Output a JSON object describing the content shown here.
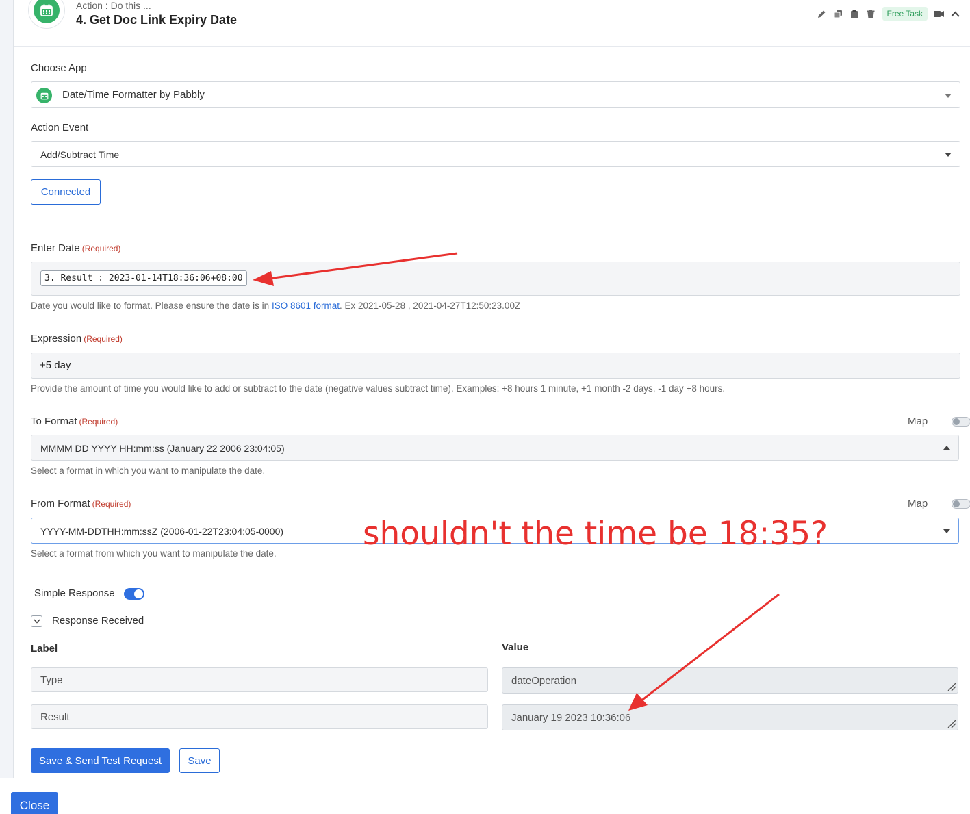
{
  "header": {
    "subtitle": "Action : Do this ...",
    "title": "4. Get Doc Link Expiry Date",
    "badge": "Free Task"
  },
  "choose_app": {
    "label": "Choose App",
    "value": "Date/Time Formatter by Pabbly"
  },
  "action_event": {
    "label": "Action Event",
    "value": "Add/Subtract Time"
  },
  "connected_button": "Connected",
  "enter_date": {
    "label": "Enter Date",
    "required": "(Required)",
    "token": "3. Result : 2023-01-14T18:36:06+08:00",
    "help_prefix": "Date you would like to format. Please ensure the date is in ",
    "help_link": "ISO 8601 format",
    "help_suffix": ". Ex 2021-05-28 , 2021-04-27T12:50:23.00Z"
  },
  "expression": {
    "label": "Expression",
    "required": "(Required)",
    "value": "+5 day",
    "help": "Provide the amount of time you would like to add or subtract to the date (negative values subtract time). Examples: +8 hours 1 minute, +1 month -2 days, -1 day +8 hours."
  },
  "to_format": {
    "label": "To Format",
    "required": "(Required)",
    "map_label": "Map",
    "value": "MMMM DD YYYY HH:mm:ss (January 22 2006 23:04:05)",
    "help": "Select a format in which you want to manipulate the date."
  },
  "from_format": {
    "label": "From Format",
    "required": "(Required)",
    "map_label": "Map",
    "value": "YYYY-MM-DDTHH:mm:ssZ (2006-01-22T23:04:05-0000)",
    "help": "Select a format from which you want to manipulate the date."
  },
  "simple_response": {
    "label": "Simple Response",
    "enabled": true
  },
  "response_received": {
    "label": "Response Received",
    "col_label": "Label",
    "col_value": "Value",
    "rows": [
      {
        "label": "Type",
        "value": "dateOperation"
      },
      {
        "label": "Result",
        "value": "January 19 2023 10:36:06"
      }
    ]
  },
  "buttons": {
    "save_send": "Save & Send Test Request",
    "save": "Save",
    "close": "Close"
  },
  "annotation": "shouldn't the time be 18:35?",
  "colors": {
    "primary": "#2f6fe0",
    "app_green": "#37b36a",
    "annotation_red": "#e8312f",
    "required_red": "#c0392b"
  },
  "icons": [
    "calendar-icon",
    "pencil-icon",
    "copy-icon",
    "clipboard-icon",
    "trash-icon",
    "video-icon",
    "chevron-up-icon",
    "chevron-down-icon"
  ]
}
